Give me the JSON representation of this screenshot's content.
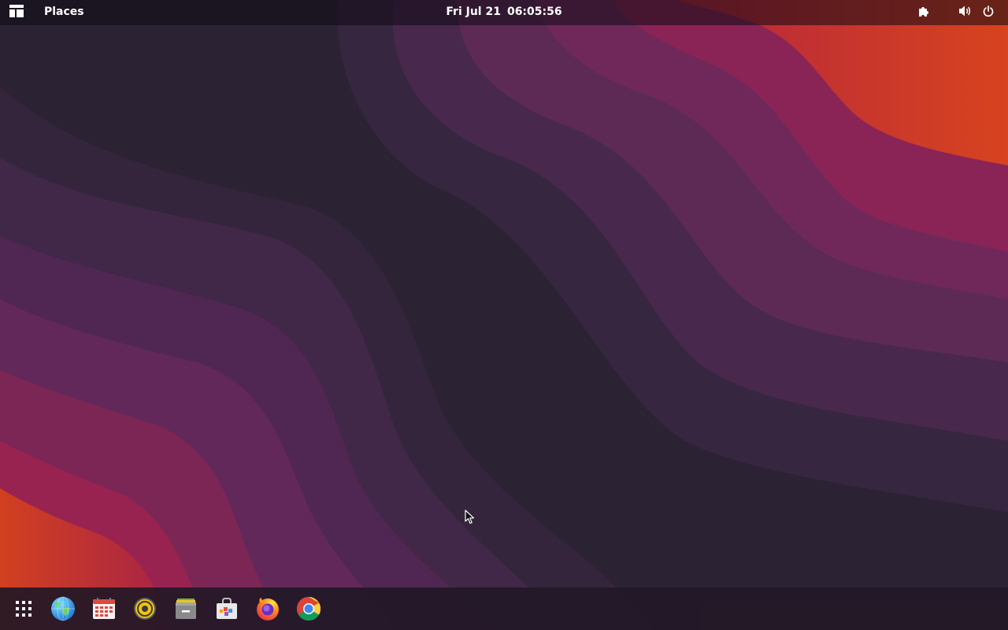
{
  "topbar": {
    "places_label": "Places",
    "clock_date": "Fri Jul 21",
    "clock_time": "06:05:56"
  },
  "icons": {
    "activities": "apps-overview-icon",
    "extensions": "puzzle-piece-icon",
    "volume": "speaker-volume-icon",
    "power": "power-icon"
  },
  "dock": {
    "items": [
      {
        "name": "show-applications",
        "icon": "grid-dots-icon"
      },
      {
        "name": "web-browser",
        "icon": "globe-icon"
      },
      {
        "name": "calendar",
        "icon": "calendar-icon"
      },
      {
        "name": "rhythmbox",
        "icon": "music-player-icon"
      },
      {
        "name": "files",
        "icon": "file-cabinet-icon"
      },
      {
        "name": "software",
        "icon": "software-bag-icon"
      },
      {
        "name": "firefox",
        "icon": "firefox-icon"
      },
      {
        "name": "chrome",
        "icon": "chrome-icon"
      }
    ]
  },
  "colors": {
    "topbar_bg": "#1a1419",
    "dock_bg": "#221826",
    "wallpaper_dark": "#2a2233",
    "wallpaper_purple": "#6a2858",
    "wallpaper_magenta": "#9b2350",
    "wallpaper_orange": "#d9441d"
  }
}
